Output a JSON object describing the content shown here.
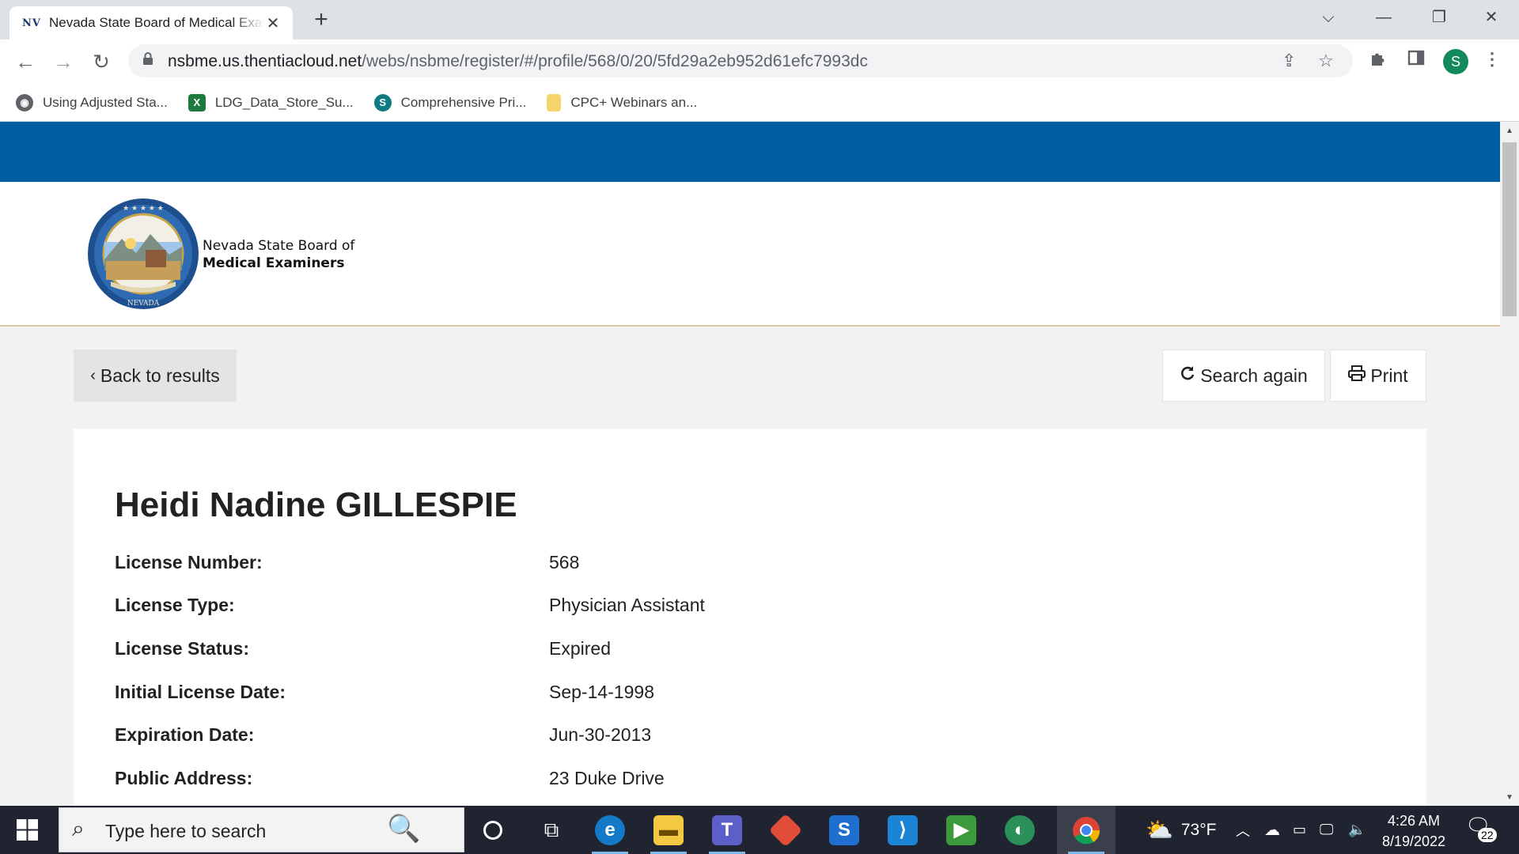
{
  "browser": {
    "tab": {
      "favicon": "NV",
      "title": "Nevada State Board of Medical Examiners"
    },
    "new_tab": "+",
    "url_host": "nsbme.us.thentiacloud.net",
    "url_path": "/webs/nsbme/register/#/profile/568/0/20/5fd29a2eb952d61efc7993dc",
    "avatar_letter": "S",
    "bookmarks": [
      {
        "label": "Using Adjusted Sta...",
        "icon": "globe-icon"
      },
      {
        "label": "LDG_Data_Store_Su...",
        "icon": "excel-icon",
        "glyph": "X"
      },
      {
        "label": "Comprehensive Pri...",
        "icon": "sharepoint-icon",
        "glyph": "S"
      },
      {
        "label": "CPC+ Webinars an...",
        "icon": "folder-icon"
      }
    ]
  },
  "site": {
    "brand_line1": "Nevada State Board of",
    "brand_line2": "Medical Examiners",
    "seal_text": "THE GREAT SEAL OF THE STATE OF NEVADA",
    "seal_motto": "ALL FOR OUR COUNTRY"
  },
  "actions": {
    "back_label": "Back to results",
    "search_again_label": "Search again",
    "print_label": "Print"
  },
  "profile": {
    "name": "Heidi Nadine GILLESPIE",
    "fields": [
      {
        "label": "License Number:",
        "value": "568"
      },
      {
        "label": "License Type:",
        "value": "Physician Assistant"
      },
      {
        "label": "License Status:",
        "value": "Expired"
      },
      {
        "label": "Initial License Date:",
        "value": "Sep-14-1998"
      },
      {
        "label": "Expiration Date:",
        "value": "Jun-30-2013"
      },
      {
        "label": "Public Address:",
        "value": "23 Duke Drive"
      }
    ]
  },
  "taskbar": {
    "search_placeholder": "Type here to search",
    "weather": "73°F",
    "time": "4:26 AM",
    "date": "8/19/2022",
    "notification_count": "22"
  }
}
